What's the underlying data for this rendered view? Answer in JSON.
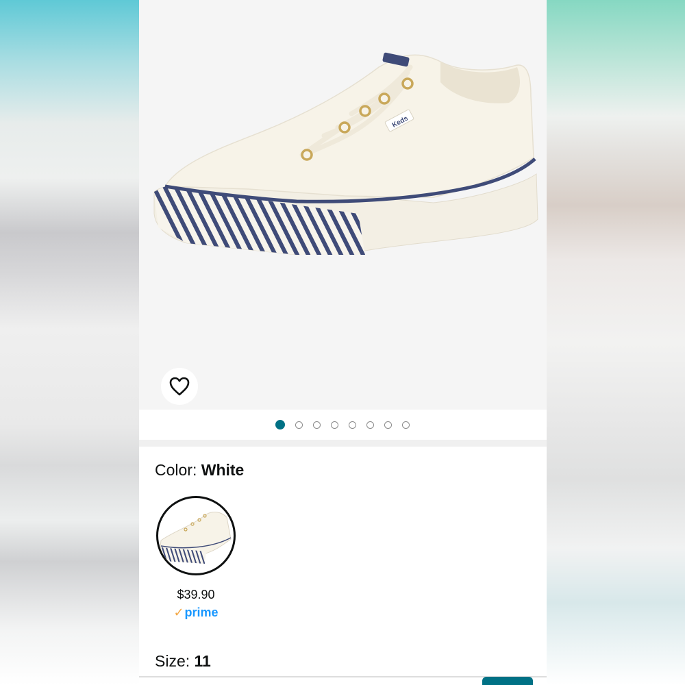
{
  "product": {
    "color_label": "Color:",
    "color_value": "White",
    "size_label": "Size:",
    "size_value": "11"
  },
  "gallery": {
    "image_count": 8,
    "active_index": 0,
    "wishlist_icon": "heart-icon"
  },
  "variant": {
    "price": "$39.90",
    "prime_check": "✓",
    "prime_label": "prime"
  },
  "colors": {
    "accent": "#007185",
    "prime_blue": "#1a98ff",
    "prime_check": "#f3a847",
    "stripe_navy": "#3f4b78"
  },
  "brand_tag": "Keds"
}
